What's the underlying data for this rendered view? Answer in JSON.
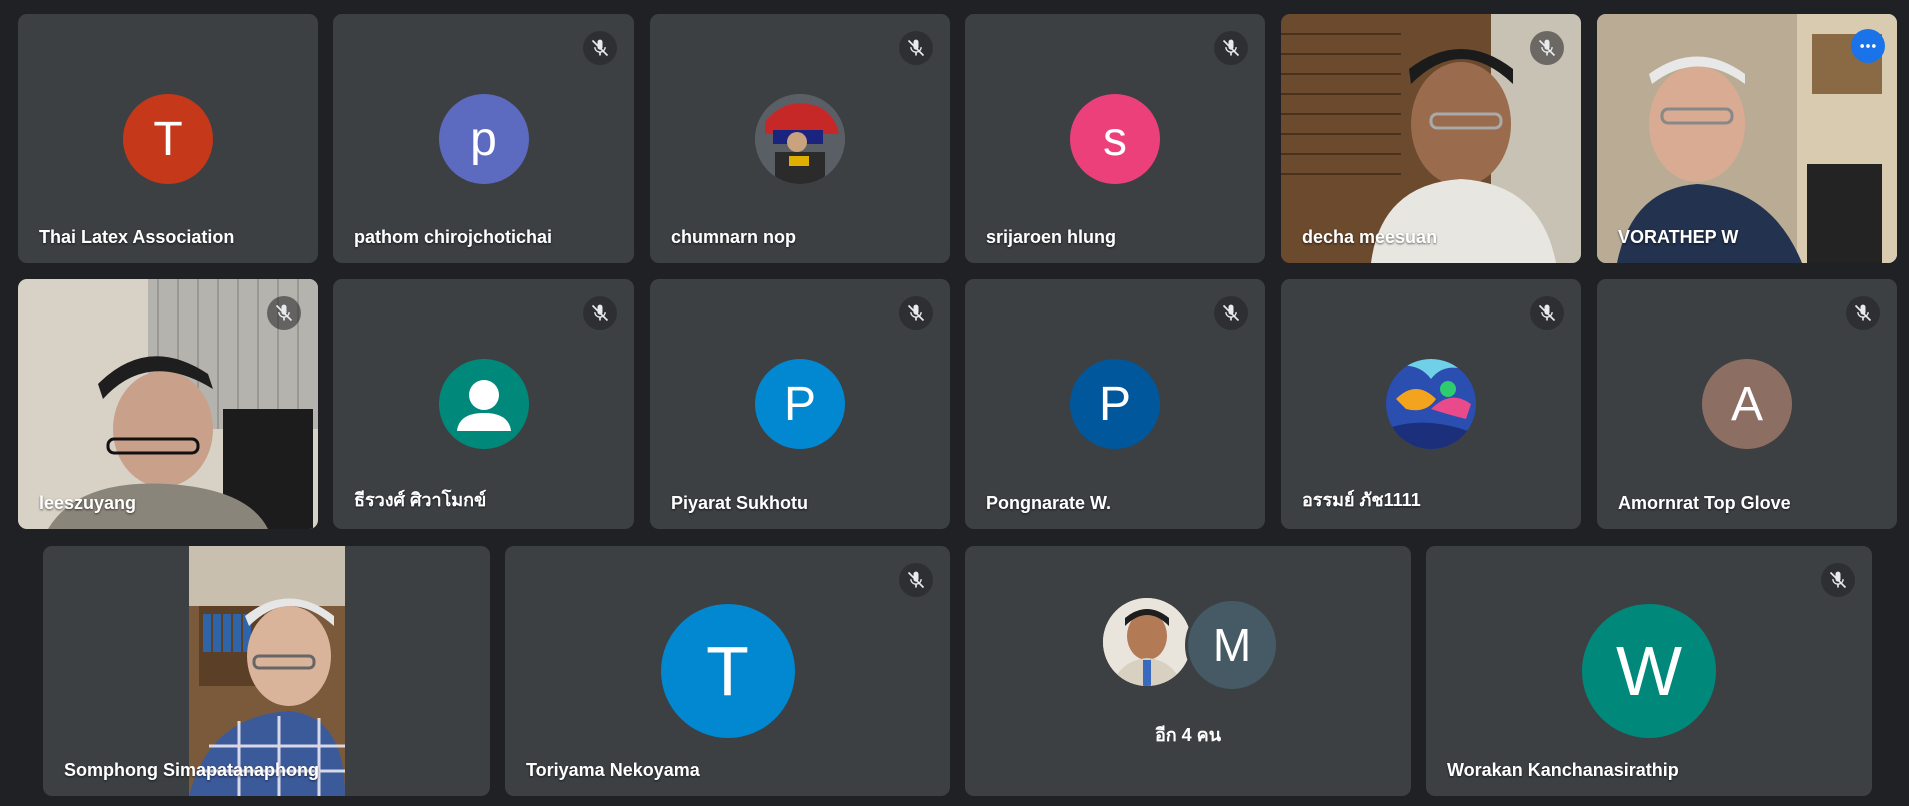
{
  "participants": [
    {
      "name": "Thai Latex Association",
      "initial": "T",
      "avatar_color": "#c5391a",
      "muted": false
    },
    {
      "name": "pathom chirojchotichai",
      "initial": "p",
      "avatar_color": "#5c6bc0",
      "muted": true
    },
    {
      "name": "chumnarn nop",
      "avatar_type": "photo",
      "muted": true
    },
    {
      "name": "srijaroen hlung",
      "initial": "s",
      "avatar_color": "#ec407a",
      "muted": true
    },
    {
      "name": "decha meesuan",
      "avatar_type": "video",
      "muted": true
    },
    {
      "name": "VORATHEP W",
      "avatar_type": "video",
      "muted": false,
      "speaking": true
    },
    {
      "name": "leeszuyang",
      "avatar_type": "video",
      "muted": true
    },
    {
      "name": "ธีรวงศ์ ศิวาโมกข์",
      "avatar_type": "person-icon",
      "avatar_color": "#00897b",
      "muted": true
    },
    {
      "name": "Piyarat Sukhotu",
      "initial": "P",
      "avatar_color": "#0288d1",
      "muted": true
    },
    {
      "name": "Pongnarate W.",
      "initial": "P",
      "avatar_color": "#01579b",
      "muted": true
    },
    {
      "name": "อรรมย์ ภัช1111",
      "avatar_type": "artwork",
      "muted": true
    },
    {
      "name": "Amornrat Top Glove",
      "initial": "A",
      "avatar_color": "#8d6e63",
      "muted": true
    },
    {
      "name": "Somphong Simapatanaphong",
      "avatar_type": "video",
      "muted": false
    },
    {
      "name": "Toriyama Nekoyama",
      "initial": "T",
      "avatar_color": "#0288d1",
      "muted": true
    },
    {
      "name": "Worakan Kanchanasirathip",
      "initial": "W",
      "avatar_color": "#00897b",
      "muted": true
    }
  ],
  "others_tile": {
    "label": "อีก 4 คน",
    "initial": "M",
    "initial_color": "#455a64"
  },
  "icons": {
    "mute": "mic-off-icon",
    "more": "more-options-icon",
    "person": "person-icon"
  },
  "colors": {
    "background": "#202124",
    "tile": "#3c4043",
    "active_border": "#8ab4f8"
  }
}
